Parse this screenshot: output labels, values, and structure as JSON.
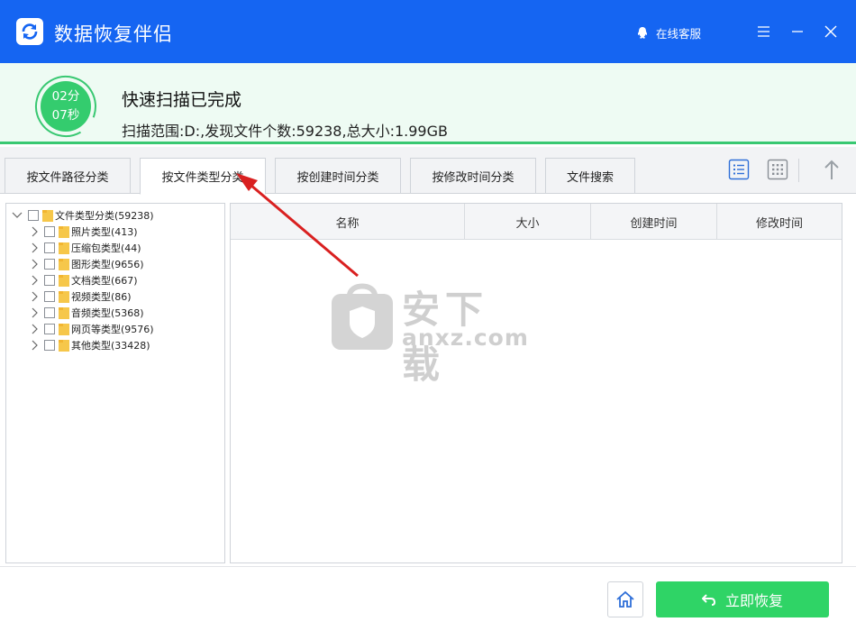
{
  "app": {
    "title": "数据恢复伴侣",
    "service_label": "在线客服"
  },
  "status": {
    "timer_min": "02分",
    "timer_sec": "07秒",
    "title": "快速扫描已完成",
    "detail": "扫描范围:D:,发现文件个数:59238,总大小:1.99GB"
  },
  "tabs": [
    {
      "label": "按文件路径分类",
      "active": false
    },
    {
      "label": "按文件类型分类",
      "active": true
    },
    {
      "label": "按创建时间分类",
      "active": false
    },
    {
      "label": "按修改时间分类",
      "active": false
    },
    {
      "label": "文件搜索",
      "active": false
    }
  ],
  "tree": {
    "root": {
      "label": "文件类型分类(59238)"
    },
    "children": [
      {
        "label": "照片类型(413)"
      },
      {
        "label": "压缩包类型(44)"
      },
      {
        "label": "图形类型(9656)"
      },
      {
        "label": "文档类型(667)"
      },
      {
        "label": "视频类型(86)"
      },
      {
        "label": "音频类型(5368)"
      },
      {
        "label": "网页等类型(9576)"
      },
      {
        "label": "其他类型(33428)"
      }
    ]
  },
  "list": {
    "columns": [
      "名称",
      "大小",
      "创建时间",
      "修改时间"
    ]
  },
  "watermark": {
    "cn": "安下载",
    "en": "anxz.com"
  },
  "actions": {
    "recover_label": "立即恢复"
  },
  "colors": {
    "titlebar": "#1565f2",
    "accent_green": "#2fd466",
    "status_bg": "#eefbf3",
    "annotation_arrow": "#d92020"
  }
}
